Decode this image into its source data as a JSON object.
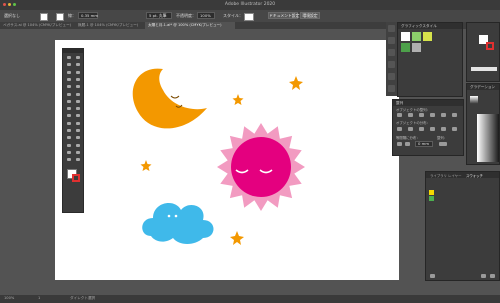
{
  "app": {
    "title": "Adobe Illustrator 2020"
  },
  "control_bar": {
    "selection_label": "選択なし",
    "stroke_label": "線：",
    "stroke_width": "0.35 mm",
    "brush_label": "5 pt. 丸筆",
    "opacity_label": "不透明度：",
    "opacity_value": "100%",
    "style_label": "スタイル：",
    "doc_setup_button": "ドキュメント設定",
    "preferences_button": "環境設定"
  },
  "tabs": [
    {
      "label": "ペガサス.ai @ 104% (CMYK/プレビュー)"
    },
    {
      "label": "無題-1 @ 104% (CMYK/プレビュー)"
    },
    {
      "label": "太陽と月-1.ai* @ 100% (CMYK/プレビュー)"
    }
  ],
  "status_bar": {
    "zoom": "100%",
    "artboard": "1",
    "tool": "ダイレクト選択"
  },
  "panels": {
    "graphic_styles": {
      "title": "グラフィックスタイル"
    },
    "align": {
      "title": "整列",
      "objects_label": "オブジェクトの整列：",
      "distribute_label": "オブジェクトの分布：",
      "spacing_label": "等間隔に分布：",
      "align_to_label": "整列：",
      "spacing_value": "0 mm"
    },
    "gradient": {
      "title": "グラデーション"
    },
    "layers": {
      "tabs": [
        "ライブラリ",
        "レイヤー",
        "スウォッチ"
      ]
    }
  },
  "artwork": {
    "moon_color": "#f39800",
    "sun_ray_color": "#f29bc1",
    "sun_body_color": "#e4007f",
    "cloud_color": "#3fb9ea",
    "star_color": "#f39800"
  }
}
